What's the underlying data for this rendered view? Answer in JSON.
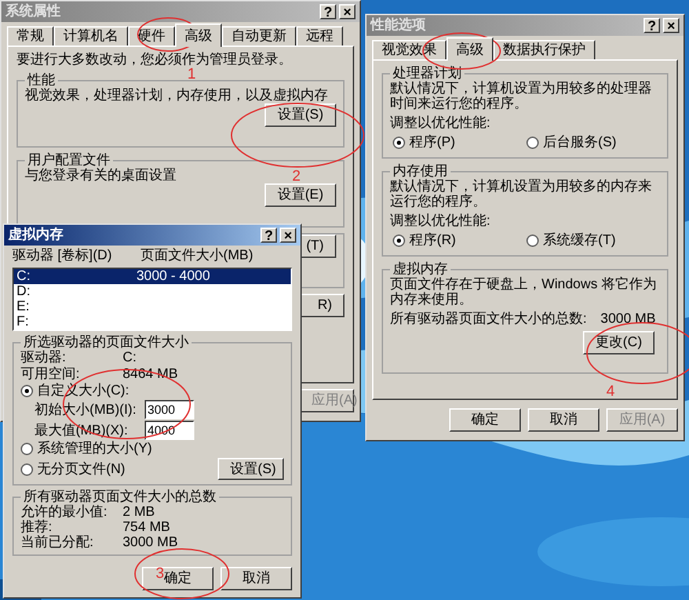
{
  "system_properties": {
    "title": "系统属性",
    "active": false,
    "help": "?",
    "close": "×",
    "tabs": [
      {
        "label": "常规",
        "selected": false
      },
      {
        "label": "计算机名",
        "selected": false
      },
      {
        "label": "硬件",
        "selected": false
      },
      {
        "label": "高级",
        "selected": true
      },
      {
        "label": "自动更新",
        "selected": false
      },
      {
        "label": "远程",
        "selected": false
      }
    ],
    "notice": "要进行大多数改动，您必须作为管理员登录。",
    "groups": [
      {
        "title": "性能",
        "description": "视觉效果，处理器计划，内存使用，以及虚拟内存",
        "button": "设置(S)"
      },
      {
        "title": "用户配置文件",
        "description": "与您登录有关的桌面设置",
        "button": "设置(E)"
      }
    ],
    "partial_buttons": [
      "(T)",
      "R)"
    ],
    "apply_button": {
      "label": "应用(A)",
      "disabled": true
    }
  },
  "virtual_memory": {
    "title": "虚拟内存",
    "active": true,
    "help": "?",
    "close": "×",
    "columns": [
      "驱动器 [卷标](D)",
      "页面文件大小(MB)"
    ],
    "drives": [
      {
        "drive": "C:",
        "size": "3000 - 4000",
        "selected": true
      },
      {
        "drive": "D:",
        "selected": false
      },
      {
        "drive": "E:",
        "selected": false
      },
      {
        "drive": "F:",
        "selected": false
      }
    ],
    "selected_group": {
      "title": "所选驱动器的页面文件大小",
      "info": [
        {
          "label": "驱动器:",
          "value": "C:"
        },
        {
          "label": "可用空间:",
          "value": "8464 MB"
        }
      ],
      "custom_radio": {
        "label": "自定义大小(C):",
        "selected": true
      },
      "fields": [
        {
          "label": "初始大小(MB)(I):",
          "value": "3000"
        },
        {
          "label": "最大值(MB)(X):",
          "value": "4000"
        }
      ],
      "system_radio": {
        "label": "系统管理的大小(Y)",
        "selected": false
      },
      "none_radio": {
        "label": "无分页文件(N)",
        "selected": false
      },
      "set_button": "设置(S)"
    },
    "totals_group": {
      "title": "所有驱动器页面文件大小的总数",
      "info": [
        {
          "label": "允许的最小值:",
          "value": "2 MB"
        },
        {
          "label": "推荐:",
          "value": "754 MB"
        },
        {
          "label": "当前已分配:",
          "value": "3000 MB"
        }
      ]
    },
    "buttons": [
      {
        "label": "确定",
        "disabled": false
      },
      {
        "label": "取消",
        "disabled": false
      }
    ]
  },
  "performance_options": {
    "title": "性能选项",
    "active": false,
    "help": "?",
    "close": "×",
    "tabs": [
      {
        "label": "视觉效果",
        "selected": false
      },
      {
        "label": "高级",
        "selected": true
      },
      {
        "label": "数据执行保护",
        "selected": false
      }
    ],
    "groups": [
      {
        "title": "处理器计划",
        "description": "默认情况下，计算机设置为用较多的处理器时间来运行您的程序。",
        "prompt": "调整以优化性能:",
        "options": [
          {
            "label": "程序(P)",
            "selected": true
          },
          {
            "label": "后台服务(S)",
            "selected": false
          }
        ]
      },
      {
        "title": "内存使用",
        "description": "默认情况下，计算机设置为用较多的内存来运行您的程序。",
        "prompt": "调整以优化性能:",
        "options": [
          {
            "label": "程序(R)",
            "selected": true
          },
          {
            "label": "系统缓存(T)",
            "selected": false
          }
        ]
      }
    ],
    "virtual_memory_group": {
      "title": "虚拟内存",
      "description": "页面文件存在于硬盘上，Windows 将它作为内存来使用。",
      "total_label": "所有驱动器页面文件大小的总数:",
      "total_value": "3000 MB",
      "button": "更改(C)"
    },
    "buttons": [
      {
        "label": "确定",
        "disabled": false
      },
      {
        "label": "取消",
        "disabled": false
      },
      {
        "label": "应用(A)",
        "disabled": true
      }
    ]
  },
  "annotations": [
    {
      "kind": "numbered",
      "label": "1"
    },
    {
      "kind": "numbered",
      "label": "2"
    },
    {
      "kind": "plain"
    },
    {
      "kind": "numbered",
      "label": "3"
    },
    {
      "kind": "plain"
    },
    {
      "kind": "numbered",
      "label": "4"
    }
  ]
}
